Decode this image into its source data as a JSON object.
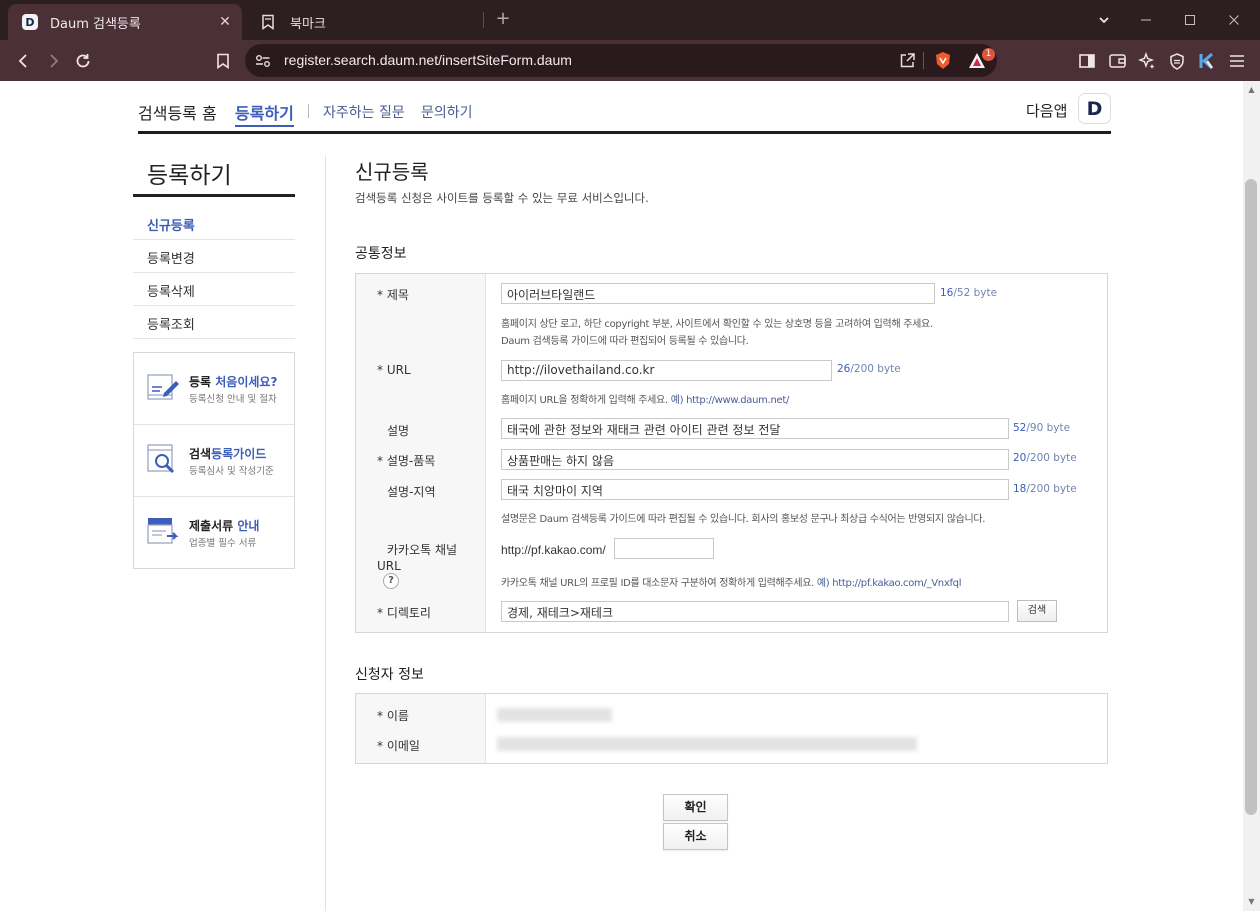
{
  "browser": {
    "tabs": [
      {
        "title": "Daum 검색등록",
        "favicon": "D"
      },
      {
        "title": "북마크"
      }
    ],
    "url": "register.search.daum.net/insertSiteForm.daum",
    "shield_badge": "1"
  },
  "nav": {
    "home": "검색등록 홈",
    "register": "등록하기",
    "faq": "자주하는 질문",
    "contact": "문의하기",
    "app": "다음앱",
    "app_logo": "D"
  },
  "sidebar": {
    "title": "등록하기",
    "items": [
      {
        "label": "신규등록"
      },
      {
        "label": "등록변경"
      },
      {
        "label": "등록삭제"
      },
      {
        "label": "등록조회"
      }
    ],
    "cards": [
      {
        "title_a": "등록 ",
        "title_b": "처음이세요?",
        "sub": "등록신청 안내 및 절차",
        "icon": "pencil-doc-icon"
      },
      {
        "title_a": "검색",
        "title_b": "등록가이드",
        "sub": "등록심사 및 작성기준",
        "icon": "magnifier-doc-icon"
      },
      {
        "title_a": "제출서류 ",
        "title_b": "안내",
        "sub": "업종별 필수 서류",
        "icon": "stacked-docs-icon"
      }
    ]
  },
  "main": {
    "title": "신규등록",
    "desc": "검색등록 신청은 사이트를 등록할 수 있는 무료 서비스입니다.",
    "common_section": "공통정보",
    "applicant_section": "신청자 정보"
  },
  "form": {
    "title": {
      "label": "* 제목",
      "value": "아이러브타일랜드",
      "count": "16",
      "limit": "/52 byte",
      "help1": "홈페이지 상단 로고, 하단 copyright 부분, 사이트에서 확인할 수 있는 상호명 등을 고려하여 입력해 주세요.",
      "help2": "Daum 검색등록 가이드에 따라 편집되어 등록될 수 있습니다."
    },
    "url": {
      "label": "* URL",
      "value": "http://ilovethailand.co.kr",
      "count": "26",
      "limit": "/200 byte",
      "help": "홈페이지 URL을 정확하게 입력해 주세요. ",
      "help_ex": "예) http://www.daum.net/"
    },
    "desc": {
      "label": "설명",
      "value": "태국에 관한 정보와 재태크 관련 아이티 관련 정보 전달",
      "count": "52",
      "limit": "/90 byte"
    },
    "desc_product": {
      "label": "* 설명-품목",
      "value": "상품판매는 하지 않음",
      "count": "20",
      "limit": "/200 byte"
    },
    "desc_region": {
      "label": "설명-지역",
      "value": "태국 치앙마이 지역",
      "count": "18",
      "limit": "/200 byte",
      "help": "설명문은 Daum 검색등록 가이드에 따라 편집될 수 있습니다. 회사의 홍보성 문구나 최상급 수식어는 반영되지 않습니다."
    },
    "kakao": {
      "label1": "카카오톡 채널",
      "label2": "URL",
      "prefix": "http://pf.kakao.com/",
      "value": "",
      "qmark": "?",
      "help": "카카오톡 채널 URL의 프로필 ID를 대소문자 구분하여 정확하게 입력해주세요. ",
      "help_ex": "예) http://pf.kakao.com/_Vnxfql"
    },
    "directory": {
      "label": "* 디렉토리",
      "value": "경제, 재테크>재테크",
      "button": "검색"
    }
  },
  "applicant": {
    "name_label": "* 이름",
    "email_label": "* 이메일"
  },
  "actions": {
    "confirm": "확인",
    "cancel": "취소"
  }
}
